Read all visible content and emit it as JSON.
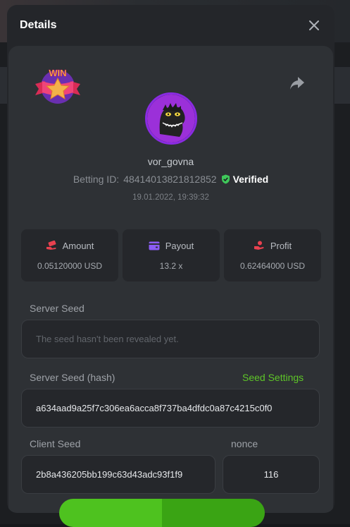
{
  "modal": {
    "title": "Details"
  },
  "player": {
    "username": "vor_govna",
    "betting_id_label": "Betting ID:",
    "betting_id": "48414013821812852",
    "verified_label": "Verified",
    "timestamp": "19.01.2022, 19:39:32"
  },
  "badge": {
    "text": "WIN"
  },
  "stats": {
    "amount": {
      "label": "Amount",
      "value": "0.05120000 USD"
    },
    "payout": {
      "label": "Payout",
      "value": "13.2 x"
    },
    "profit": {
      "label": "Profit",
      "value": "0.62464000 USD"
    }
  },
  "server_seed": {
    "label": "Server Seed",
    "placeholder": "The seed hasn't been revealed yet."
  },
  "server_seed_hash": {
    "label": "Server Seed (hash)",
    "settings_link": "Seed Settings",
    "value": "a634aad9a25f7c306ea6acca8f737ba4dfdc0a87c4215c0f0"
  },
  "client_seed": {
    "label": "Client Seed",
    "value": "2b8a436205bb199c63d43adc93f1f9"
  },
  "nonce": {
    "label": "nonce",
    "value": "116"
  },
  "colors": {
    "accent": "#5ec528",
    "verified": "#3fc85a",
    "avatar_ring": "#8a2be2",
    "icon_red": "#e8414f",
    "icon_purple": "#8b5cf6"
  }
}
